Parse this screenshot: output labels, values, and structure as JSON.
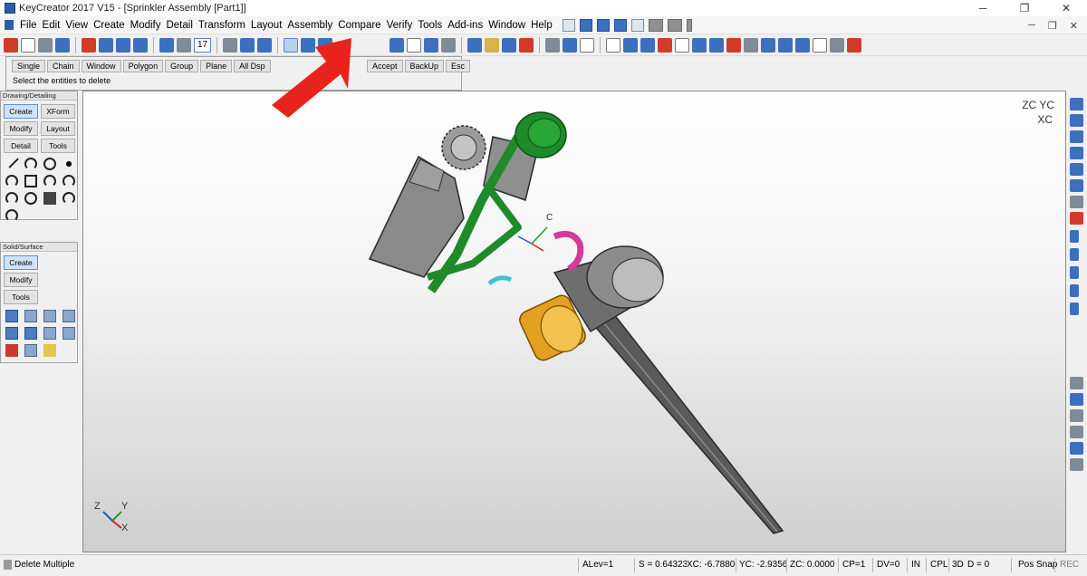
{
  "window": {
    "title": "KeyCreator 2017 V15 - [Sprinkler Assembly [Part1]]",
    "controls": [
      "─",
      "❐",
      "✕"
    ],
    "mdi_controls": [
      "─",
      "❐",
      "✕"
    ]
  },
  "menu": {
    "items": [
      "File",
      "Edit",
      "View",
      "Create",
      "Modify",
      "Detail",
      "Transform",
      "Layout",
      "Assembly",
      "Compare",
      "Verify",
      "Tools",
      "Add-ins",
      "Window",
      "Help"
    ]
  },
  "toolbar": {
    "level_value": "17"
  },
  "prompt": {
    "buttons": [
      "Single",
      "Chain",
      "Window",
      "Polygon",
      "Group",
      "Plane",
      "All Dsp"
    ],
    "buttons_right": [
      "Accept",
      "BackUp",
      "Esc"
    ],
    "message": "Select the entities to delete"
  },
  "palettes": {
    "drawing": {
      "title": "Drawing/Detailing",
      "buttons": [
        "Create",
        "XForm",
        "Modify",
        "Layout",
        "Detail",
        "Tools"
      ]
    },
    "solid": {
      "title": "Solid/Surface",
      "buttons": [
        "Create",
        "Modify",
        "Tools"
      ]
    }
  },
  "viewport": {
    "orientation_top_right": "ZC YC",
    "orientation_top_right_2": "XC",
    "triad_label": "C",
    "triad_z": "Z",
    "triad_y": "Y",
    "triad_x": "X"
  },
  "status": {
    "mode": "Delete Multiple",
    "alev": "ALev=1",
    "scale": "S = 0.643235",
    "xc": "XC: -6.7880",
    "yc": "YC: -2.9356",
    "zc": "ZC: 0.0000",
    "cp": "CP=1",
    "dv": "DV=0",
    "in": "IN",
    "cpl": "CPL",
    "threed": "3D",
    "d": "D = 0",
    "snap": "Pos Snap",
    "rec": "REC"
  },
  "colors": {
    "accent_arrow": "#e8231c",
    "model_green": "#1f8a2a",
    "model_gray": "#8c8c8c",
    "model_orange": "#e3a020",
    "model_magenta": "#d43a9a"
  }
}
